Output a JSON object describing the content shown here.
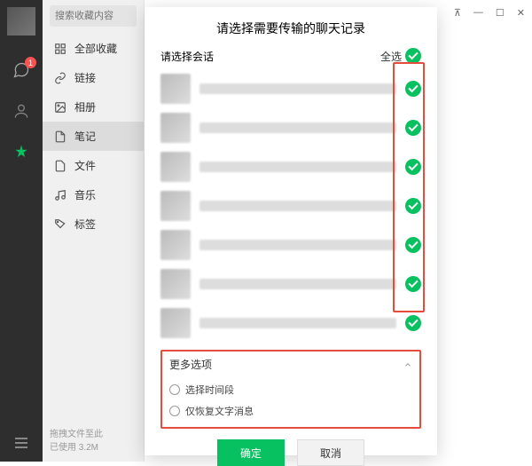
{
  "window": {
    "pin": "📌",
    "min": "—",
    "max": "☐",
    "close": "✕"
  },
  "rail": {
    "badge": "1"
  },
  "search": {
    "placeholder": "搜索收藏内容"
  },
  "sidebar": {
    "items": [
      {
        "label": "全部收藏"
      },
      {
        "label": "链接"
      },
      {
        "label": "相册"
      },
      {
        "label": "笔记"
      },
      {
        "label": "文件"
      },
      {
        "label": "音乐"
      },
      {
        "label": "标签"
      }
    ]
  },
  "footer": {
    "line1": "拖拽文件至此",
    "line2": "已使用 3.2M"
  },
  "modal": {
    "title": "请选择需要传输的聊天记录",
    "session_label": "请选择会话",
    "select_all": "全选",
    "more_label": "更多选项",
    "opt_time": "选择时间段",
    "opt_text": "仅恢复文字消息",
    "ok": "确定",
    "cancel": "取消"
  }
}
